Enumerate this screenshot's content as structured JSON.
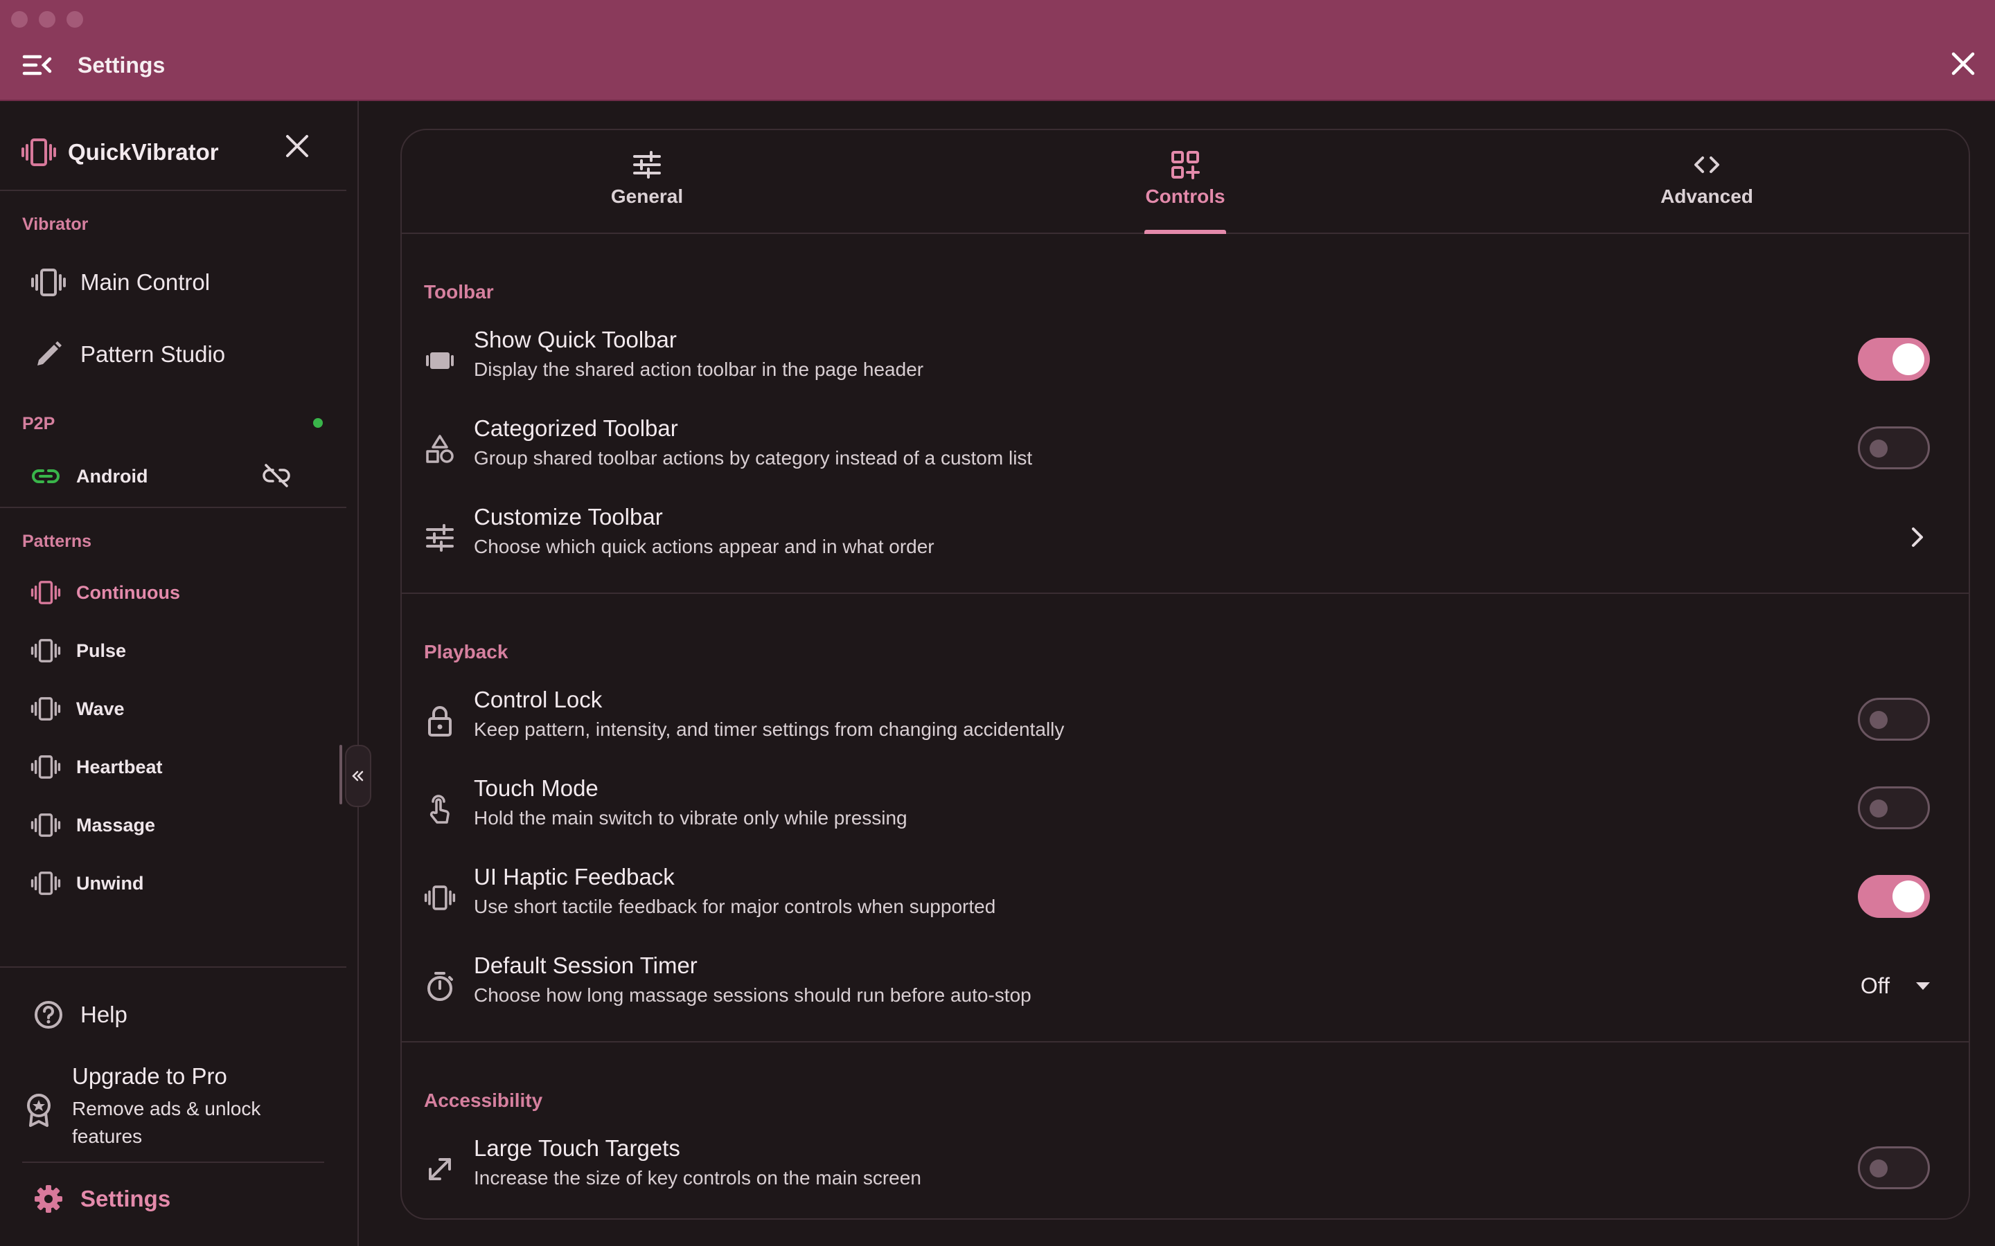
{
  "window": {
    "title": "Settings"
  },
  "sidebar": {
    "brand": "QuickVibrator",
    "sections": {
      "vibrator": "Vibrator",
      "p2p": "P2P",
      "patterns": "Patterns"
    },
    "vibrator_items": [
      {
        "label": "Main Control",
        "icon": "vibration-icon"
      },
      {
        "label": "Pattern Studio",
        "icon": "pencil-icon"
      }
    ],
    "p2p_items": [
      {
        "label": "Android",
        "icon": "link-icon",
        "status": "connected",
        "action_icon": "unlink-icon"
      }
    ],
    "pattern_items": [
      {
        "label": "Continuous",
        "active": true
      },
      {
        "label": "Pulse"
      },
      {
        "label": "Wave"
      },
      {
        "label": "Heartbeat"
      },
      {
        "label": "Massage"
      },
      {
        "label": "Unwind"
      }
    ],
    "help": "Help",
    "upgrade": {
      "title": "Upgrade to Pro",
      "subtitle": "Remove ads & unlock features"
    },
    "settings": "Settings"
  },
  "tabs": [
    {
      "label": "General",
      "icon": "tune-icon"
    },
    {
      "label": "Controls",
      "icon": "grid-add-icon",
      "active": true
    },
    {
      "label": "Advanced",
      "icon": "code-icon"
    }
  ],
  "groups": {
    "toolbar": {
      "label": "Toolbar",
      "rows": [
        {
          "title": "Show Quick Toolbar",
          "desc": "Display the shared action toolbar in the page header",
          "control": "toggle",
          "on": true
        },
        {
          "title": "Categorized Toolbar",
          "desc": "Group shared toolbar actions by category instead of a custom list",
          "control": "toggle",
          "on": false
        },
        {
          "title": "Customize Toolbar",
          "desc": "Choose which quick actions appear and in what order",
          "control": "chevron"
        }
      ]
    },
    "playback": {
      "label": "Playback",
      "rows": [
        {
          "title": "Control Lock",
          "desc": "Keep pattern, intensity, and timer settings from changing accidentally",
          "control": "toggle",
          "on": false
        },
        {
          "title": "Touch Mode",
          "desc": "Hold the main switch to vibrate only while pressing",
          "control": "toggle",
          "on": false
        },
        {
          "title": "UI Haptic Feedback",
          "desc": "Use short tactile feedback for major controls when supported",
          "control": "toggle",
          "on": true
        },
        {
          "title": "Default Session Timer",
          "desc": "Choose how long massage sessions should run before auto-stop",
          "control": "dropdown",
          "value": "Off"
        }
      ]
    },
    "accessibility": {
      "label": "Accessibility",
      "rows": [
        {
          "title": "Large Touch Targets",
          "desc": "Increase the size of key controls on the main screen",
          "control": "toggle",
          "on": false
        }
      ]
    }
  },
  "colors": {
    "titlebar": "#8a3a5b",
    "accent": "#e48aab",
    "background": "#1e1719",
    "toggle_on": "#d8799b",
    "status_green": "#39b54a"
  }
}
